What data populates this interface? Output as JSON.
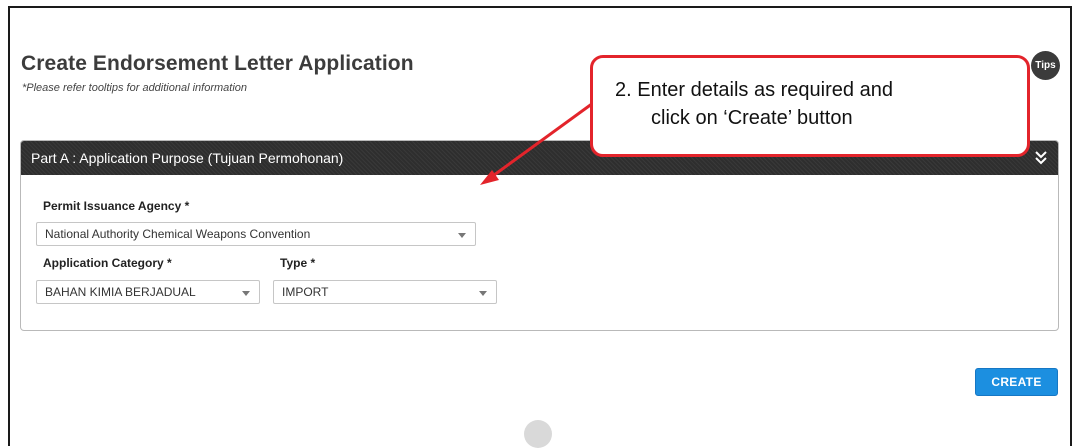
{
  "page": {
    "title": "Create Endorsement Letter Application",
    "subtitle": "*Please refer tooltips for additional information",
    "tips_label": "Tips"
  },
  "panel": {
    "header": "Part A : Application Purpose (Tujuan Permohonan)",
    "collapse_icon": "double-chevron-down-icon"
  },
  "form": {
    "agency_label": "Permit Issuance Agency *",
    "agency_value": "National Authority Chemical Weapons Convention",
    "category_label": "Application Category *",
    "category_value": "BAHAN KIMIA BERJADUAL",
    "type_label": "Type *",
    "type_value": "IMPORT"
  },
  "actions": {
    "create_label": "CREATE"
  },
  "annotation": {
    "line1": "2. Enter details as required and",
    "line2": "click on ‘Create’ button",
    "color": "#e3242b"
  }
}
